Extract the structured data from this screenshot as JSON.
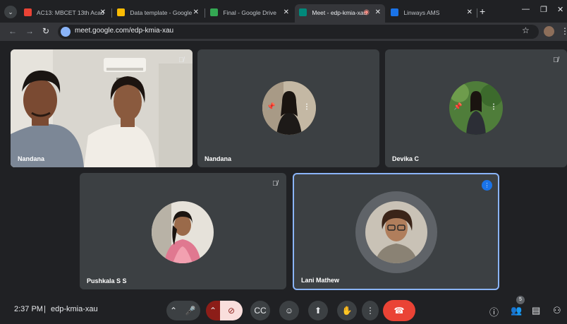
{
  "browser": {
    "tabs": [
      {
        "title": "AC13: MBCET 13th Acad",
        "fav_color": "#ea4335"
      },
      {
        "title": "Data template - Google",
        "fav_color": "#fbbc04"
      },
      {
        "title": "Final - Google Drive",
        "fav_color": "#34a853"
      },
      {
        "title": "Meet - edp-kmia-xau",
        "fav_color": "#00897b"
      },
      {
        "title": "Linways AMS",
        "fav_color": "#1a73e8"
      }
    ],
    "url": "meet.google.com/edp-kmia-xau"
  },
  "participants": [
    {
      "name": "Nandana",
      "camera_on": true
    },
    {
      "name": "Nandana",
      "camera_on": false,
      "avatar_color": "#8b7a5c"
    },
    {
      "name": "Devika C",
      "camera_on": false,
      "avatar_color": "#4a7a3a"
    },
    {
      "name": "Pushkala S S",
      "camera_on": false,
      "avatar_color": "#c86a78"
    },
    {
      "name": "Lani Mathew",
      "camera_on": false,
      "avatar_color": "#6d5a4a",
      "speaking": true
    }
  ],
  "footer": {
    "time": "2:37 PM",
    "separator": "|",
    "meeting_code": "edp-kmia-xau",
    "people_count": "5"
  },
  "colors": {
    "background": "#202124",
    "tile": "#3c4043",
    "accent_blue": "#1a73e8",
    "hangup_red": "#ea4335"
  }
}
